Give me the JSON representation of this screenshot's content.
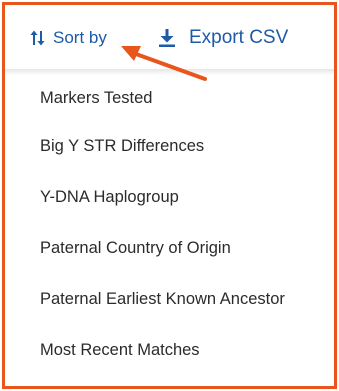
{
  "toolbar": {
    "sort_label": "Sort by",
    "sort_icon": "sort-arrows-icon",
    "export_label": "Export CSV",
    "export_icon": "download-icon",
    "accent_color": "#1d5aa8"
  },
  "annotation": {
    "frame_color": "#e8561c",
    "pointer": "arrow pointing to Sort by"
  },
  "menu": {
    "items": [
      {
        "label": "Markers Tested"
      },
      {
        "label": "Big Y STR Differences"
      },
      {
        "label": "Y-DNA Haplogroup"
      },
      {
        "label": "Paternal Country of Origin"
      },
      {
        "label": "Paternal Earliest Known Ancestor"
      },
      {
        "label": "Most Recent Matches"
      }
    ]
  }
}
